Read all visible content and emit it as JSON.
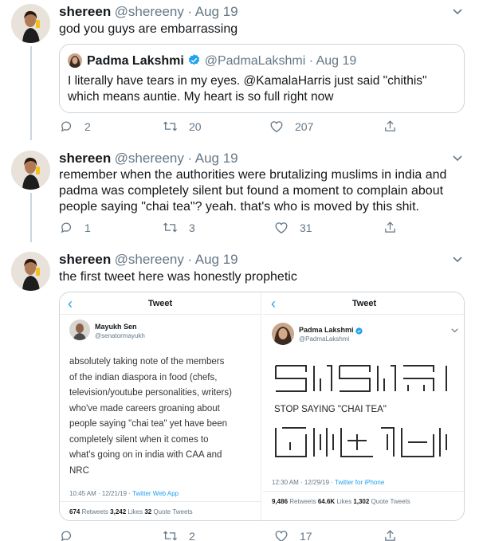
{
  "tweets": [
    {
      "name": "shereen",
      "handle": "@shereeny",
      "date": "· Aug 19",
      "text": "god you guys are embarrassing",
      "quote": {
        "name": "Padma Lakshmi",
        "handle": "@PadmaLakshmi",
        "date": "· Aug 19",
        "text_line1": "I literally have tears in my eyes. @KamalaHarris just said \"chithis\"",
        "text_line2": "which means auntie. My heart is so full right now"
      },
      "replies": "2",
      "retweets": "20",
      "likes": "207"
    },
    {
      "name": "shereen",
      "handle": "@shereeny",
      "date": "· Aug 19",
      "text_lines": [
        "remember when the authorities were brutalizing muslims in india and",
        "padma was completely silent but found a moment to complain about",
        "people saying \"chai tea\"? yeah. that's who is moved by this shit."
      ],
      "replies": "1",
      "retweets": "3",
      "likes": "31"
    },
    {
      "name": "shereen",
      "handle": "@shereeny",
      "date": "· Aug 19",
      "text": "the first tweet here was honestly prophetic",
      "replies": "",
      "retweets": "2",
      "likes": "17"
    }
  ],
  "embedded": {
    "left": {
      "header": "Tweet",
      "author": "Mayukh Sen",
      "handle": "@senatormayukh",
      "lines": [
        "absolutely taking note of the members",
        "of the indian diaspora in food (chefs,",
        "television/youtube personalities, writers)",
        "who've made careers groaning about",
        "people saying \"chai tea\" yet have been",
        "completely silent when it comes to",
        "what's going on in india with CAA and",
        "NRC"
      ],
      "time": "10:45 AM · 12/21/19 · ",
      "client": "Twitter Web App",
      "retweets": "674",
      "retweets_label": " Retweets ",
      "likes": "3,242",
      "likes_label": " Likes ",
      "quotes": "32",
      "quotes_label": " Quote Tweets"
    },
    "right": {
      "header": "Tweet",
      "author": "Padma Lakshmi",
      "handle": "@PadmaLakshmi",
      "caption": "STOP SAYING \"CHAI TEA\"",
      "time": "12:30 AM · 12/29/19 · ",
      "client": "Twitter for iPhone",
      "retweets": "9,486",
      "retweets_label": " Retweets ",
      "likes": "64.6K",
      "likes_label": " Likes ",
      "quotes": "1,302",
      "quotes_label": " Quote Tweets"
    }
  },
  "colors": {
    "accent": "#1da1f2",
    "muted": "#657786",
    "border": "#ccd6dd",
    "text": "#14171a"
  },
  "icons": [
    "avatar",
    "chevron-down-icon",
    "reply-icon",
    "retweet-icon",
    "like-icon",
    "share-icon",
    "verified-icon",
    "back-arrow-icon"
  ]
}
